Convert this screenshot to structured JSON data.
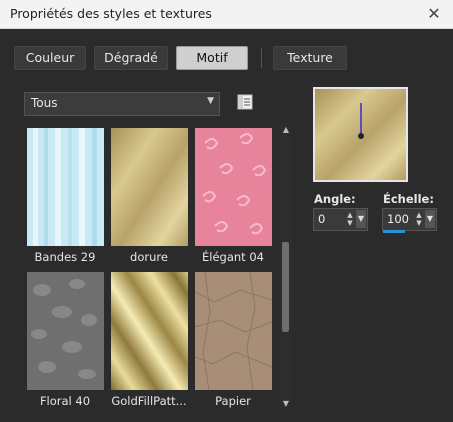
{
  "window": {
    "title": "Propriétés des styles et textures",
    "close_icon": "close-icon"
  },
  "tabs": [
    {
      "label": "Couleur",
      "active": false
    },
    {
      "label": "Dégradé",
      "active": false
    },
    {
      "label": "Motif",
      "active": true
    },
    {
      "label": "Texture",
      "active": false
    }
  ],
  "category": {
    "selected": "Tous"
  },
  "library_icon": "library-icon",
  "patterns": [
    {
      "label": "Bandes 29"
    },
    {
      "label": "dorure"
    },
    {
      "label": "Élégant 04"
    },
    {
      "label": "Floral 40"
    },
    {
      "label": "GoldFillPatt..."
    },
    {
      "label": "Papier"
    }
  ],
  "angle": {
    "label": "Angle:",
    "value": "0"
  },
  "scale": {
    "label": "Échelle:",
    "value": "100"
  },
  "colors": {
    "accent": "#2d8fd6",
    "panel": "#2b2b2b",
    "active_tab": "#cfcfcf"
  }
}
